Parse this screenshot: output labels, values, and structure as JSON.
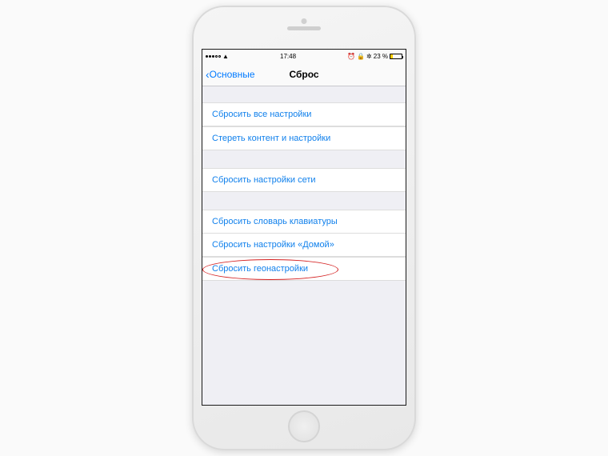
{
  "statusbar": {
    "time": "17:48",
    "battery_pct": "23 %"
  },
  "nav": {
    "back_label": "Основные",
    "title": "Сброс"
  },
  "groups": [
    {
      "rows": [
        "Сбросить все настройки",
        "Стереть контент и настройки"
      ]
    },
    {
      "rows": [
        "Сбросить настройки сети"
      ]
    },
    {
      "rows": [
        "Сбросить словарь клавиатуры",
        "Сбросить настройки «Домой»",
        "Сбросить геонастройки"
      ]
    }
  ],
  "highlighted_row": "Сбросить геонастройки"
}
